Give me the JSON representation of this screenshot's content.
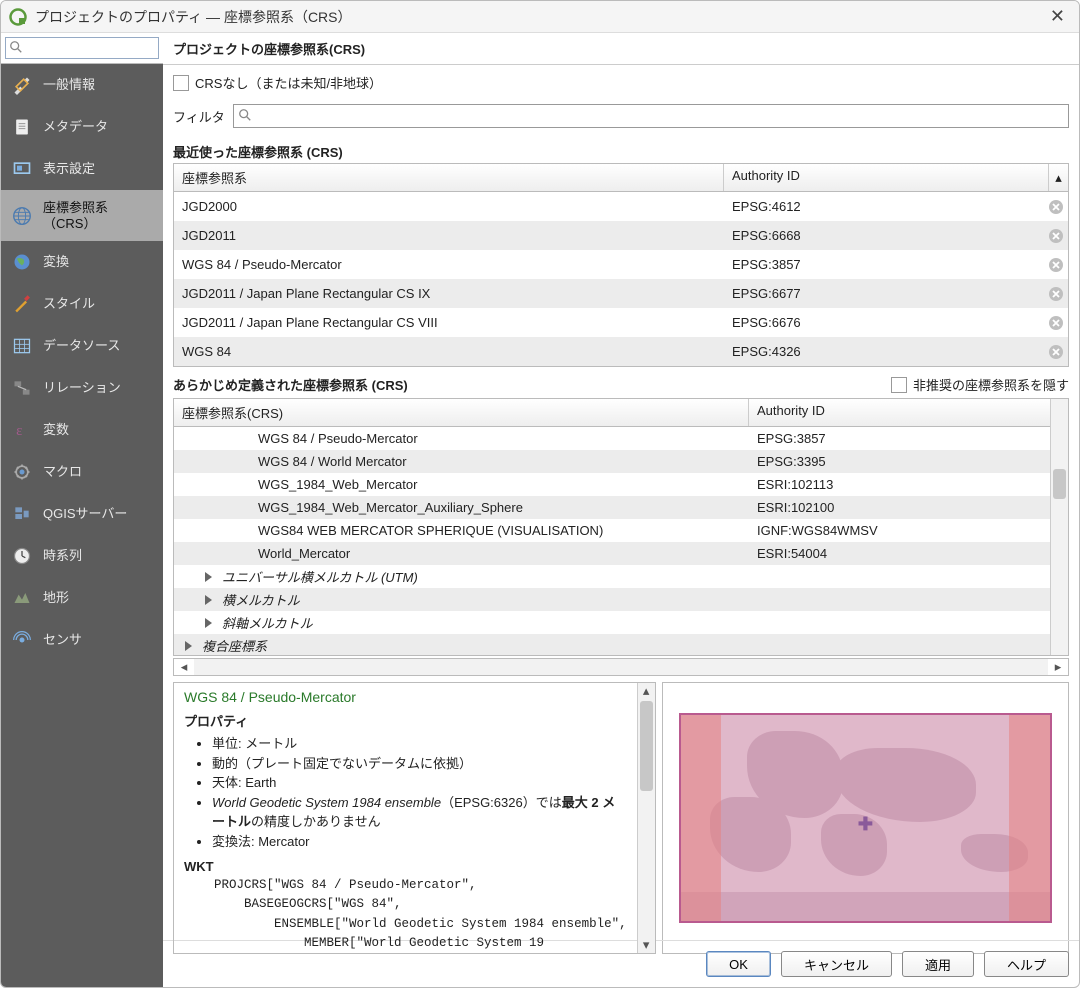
{
  "window": {
    "title": "プロジェクトのプロパティ — 座標参照系（CRS）"
  },
  "sidebar": {
    "search_placeholder": "",
    "items": [
      {
        "label": "一般情報"
      },
      {
        "label": "メタデータ"
      },
      {
        "label": "表示設定"
      },
      {
        "label": "座標参照系（CRS）"
      },
      {
        "label": "変換"
      },
      {
        "label": "スタイル"
      },
      {
        "label": "データソース"
      },
      {
        "label": "リレーション"
      },
      {
        "label": "変数"
      },
      {
        "label": "マクロ"
      },
      {
        "label": "QGISサーバー"
      },
      {
        "label": "時系列"
      },
      {
        "label": "地形"
      },
      {
        "label": "センサ"
      }
    ]
  },
  "main": {
    "section_title": "プロジェクトの座標参照系(CRS)",
    "no_crs_checkbox": "CRSなし（または未知/非地球）",
    "filter_label": "フィルタ",
    "recent_header": "最近使った座標参照系 (CRS)",
    "col_crs": "座標参照系",
    "col_auth": "Authority ID",
    "recent": [
      {
        "name": "JGD2000",
        "auth": "EPSG:4612"
      },
      {
        "name": "JGD2011",
        "auth": "EPSG:6668"
      },
      {
        "name": "WGS 84 / Pseudo-Mercator",
        "auth": "EPSG:3857"
      },
      {
        "name": "JGD2011 / Japan Plane Rectangular CS IX",
        "auth": "EPSG:6677"
      },
      {
        "name": "JGD2011 / Japan Plane Rectangular CS VIII",
        "auth": "EPSG:6676"
      },
      {
        "name": "WGS 84",
        "auth": "EPSG:4326"
      }
    ],
    "predef_header": "あらかじめ定義された座標参照系 (CRS)",
    "hide_deprecated": "非推奨の座標参照系を隠す",
    "col_crs2": "座標参照系(CRS)",
    "predef": [
      {
        "type": "leaf",
        "name": "WGS 84 / Pseudo-Mercator",
        "auth": "EPSG:3857"
      },
      {
        "type": "leaf",
        "name": "WGS 84 / World Mercator",
        "auth": "EPSG:3395"
      },
      {
        "type": "leaf",
        "name": "WGS_1984_Web_Mercator",
        "auth": "ESRI:102113"
      },
      {
        "type": "leaf",
        "name": "WGS_1984_Web_Mercator_Auxiliary_Sphere",
        "auth": "ESRI:102100"
      },
      {
        "type": "leaf",
        "name": "WGS84 WEB MERCATOR SPHERIQUE (VISUALISATION)",
        "auth": "IGNF:WGS84WMSV"
      },
      {
        "type": "leaf",
        "name": "World_Mercator",
        "auth": "ESRI:54004"
      },
      {
        "type": "group",
        "name": "ユニバーサル横メルカトル (UTM)",
        "auth": ""
      },
      {
        "type": "group",
        "name": "横メルカトル",
        "auth": ""
      },
      {
        "type": "group",
        "name": "斜軸メルカトル",
        "auth": ""
      },
      {
        "type": "group_top",
        "name": "複合座標系",
        "auth": ""
      }
    ],
    "selected_crs_name": "WGS 84 / Pseudo-Mercator",
    "properties_header": "プロパティ",
    "properties": [
      "単位: メートル",
      "動的（プレート固定でないデータムに依拠）",
      "天体: Earth",
      "World Geodetic System 1984 ensemble（EPSG:6326）では最大 2 メートルの精度しかありません",
      "変換法: Mercator"
    ],
    "wkt_header": "WKT",
    "wkt": "    PROJCRS[\"WGS 84 / Pseudo-Mercator\",\n        BASEGEOGCRS[\"WGS 84\",\n            ENSEMBLE[\"World Geodetic System 1984 ensemble\",\n                MEMBER[\"World Geodetic System 19"
  },
  "buttons": {
    "ok": "OK",
    "cancel": "キャンセル",
    "apply": "適用",
    "help": "ヘルプ"
  }
}
